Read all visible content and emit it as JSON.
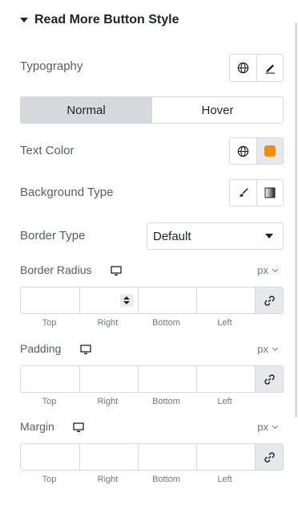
{
  "section": {
    "title": "Read More Button Style"
  },
  "typography": {
    "label": "Typography"
  },
  "state_tabs": [
    {
      "label": "Normal",
      "active": true
    },
    {
      "label": "Hover",
      "active": false
    }
  ],
  "text_color": {
    "label": "Text Color",
    "swatch_color": "#f58a0b"
  },
  "background_type": {
    "label": "Background Type"
  },
  "border_type": {
    "label": "Border Type",
    "value": "Default"
  },
  "border_radius": {
    "label": "Border Radius",
    "unit": "px"
  },
  "padding": {
    "label": "Padding",
    "unit": "px"
  },
  "margin": {
    "label": "Margin",
    "unit": "px"
  },
  "dimension_labels": [
    "Top",
    "Right",
    "Bottom",
    "Left"
  ],
  "colors": {
    "accent": "#f58a0b",
    "active_tab": "#d5d8dc",
    "border": "#d5d8dc"
  }
}
